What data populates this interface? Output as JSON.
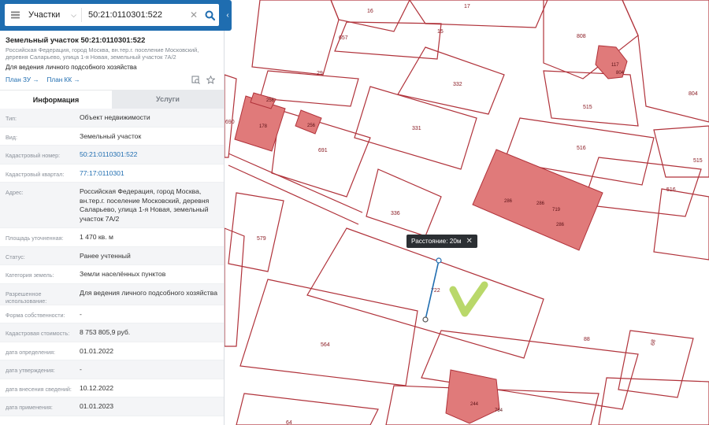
{
  "search": {
    "category": "Участки",
    "value": "50:21:0110301:522"
  },
  "info": {
    "title": "Земельный участок 50:21:0110301:522",
    "address": "Российская Федерация, город Москва, вн.тер.г. поселение Московский, деревня Саларьево, улица 1-я Новая, земельный участок 7А/2",
    "purpose": "Для ведения личного подсобного хозяйства",
    "link_zu": "План ЗУ →",
    "link_kk": "План КК →"
  },
  "tabs": [
    "Информация",
    "Услуги"
  ],
  "rows": [
    {
      "label": "Тип:",
      "value": "Объект недвижимости"
    },
    {
      "label": "Вид:",
      "value": "Земельный участок"
    },
    {
      "label": "Кадастровый номер:",
      "value": "50:21:0110301:522",
      "link": true
    },
    {
      "label": "Кадастровый квартал:",
      "value": "77:17:0110301",
      "link": true
    },
    {
      "label": "Адрес:",
      "value": "Российская Федерация, город Москва, вн.тер.г. поселение Московский, деревня Саларьево, улица 1-я Новая, земельный участок 7А/2"
    },
    {
      "label": "Площадь уточненная:",
      "value": "1 470 кв. м"
    },
    {
      "label": "Статус:",
      "value": "Ранее учтенный"
    },
    {
      "label": "Категория земель:",
      "value": "Земли населённых пунктов"
    },
    {
      "label": "Разрешенное использование:",
      "value": "Для ведения личного подсобного хозяйства"
    },
    {
      "label": "Форма собственности:",
      "value": "-"
    },
    {
      "label": "Кадастровая стоимость:",
      "value": "8 753 805,9 руб."
    },
    {
      "label": "дата определения:",
      "value": "01.01.2022"
    },
    {
      "label": "дата утверждения:",
      "value": "-"
    },
    {
      "label": "дата внесения сведений:",
      "value": "10.12.2022"
    },
    {
      "label": "дата применения:",
      "value": "01.01.2023"
    }
  ],
  "distance_label": "Расстояние: 20м",
  "map_labels": [
    "16",
    "17",
    "657",
    "15",
    "808",
    "29",
    "332",
    "117",
    "804",
    "804",
    "515",
    "690",
    "178",
    "256",
    "331",
    "256",
    "691",
    "516",
    "515",
    "516",
    "336",
    "286",
    "286",
    "719",
    "286",
    "579",
    "722",
    "564",
    "88",
    "68",
    "784",
    "244",
    "64"
  ],
  "colors": {
    "brand": "#1f6db0",
    "parcel_stroke": "#b0323a",
    "building_fill": "#e07a7a",
    "checkmark": "#b9d86a"
  },
  "icons": [
    "menu-icon",
    "chevron-down-icon",
    "clear-icon",
    "search-icon",
    "collapse-icon",
    "plan-icon",
    "star-icon",
    "close-icon",
    "checkmark-icon"
  ]
}
